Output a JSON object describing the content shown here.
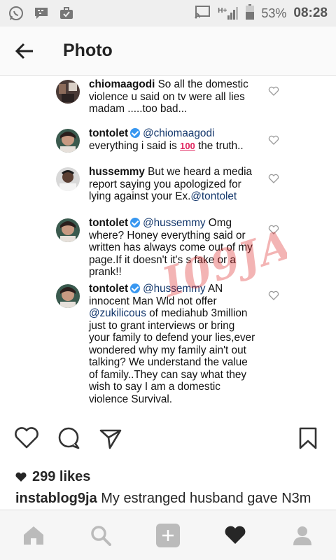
{
  "status_bar": {
    "network": "H+",
    "battery": "53%",
    "time": "08:28",
    "icons": [
      "whatsapp-icon",
      "bbm-icon",
      "briefcase-icon",
      "cast-icon",
      "signal-icon",
      "battery-icon"
    ]
  },
  "app_bar": {
    "title": "Photo"
  },
  "comments": [
    {
      "user": "chiomaagodi",
      "verified": false,
      "text": " So all the domestic violence u said on tv were all lies madam .....too bad..."
    },
    {
      "user": "tontolet",
      "verified": true,
      "mention": "@chiomaagodi",
      "text_before": " everything i said is ",
      "emoji": "100",
      "text_after": " the truth.."
    },
    {
      "user": "hussemmy",
      "verified": false,
      "text": " But we heard a media report saying you apologized for lying against your Ex.",
      "mention_end": "@tontolet"
    },
    {
      "user": "tontolet",
      "verified": true,
      "mention": "@hussemmy",
      "text": " Omg where? Honey everything said or written has always come out of my page.If it doesn't it's s fake or a prank!!"
    },
    {
      "user": "tontolet",
      "verified": true,
      "mention": "@hussemmy",
      "text1": " AN innocent Man Wld not offer ",
      "mention2": "@zukilicous",
      "text2": " of mediahub 3million just to grant interviews or bring your family to defend your lies,ever wondered why my family ain't out talking? We understand the value of family..They can say what they wish to say I am a domestic violence Survival."
    }
  ],
  "watermark": "I09JA",
  "post": {
    "likes": "299 likes",
    "caption_user": "instablog9ja",
    "caption_text": " My estranged husband gave N3m"
  },
  "colors": {
    "accent": "#3897f0",
    "mention": "#12366b",
    "watermark": "#dc2828"
  }
}
